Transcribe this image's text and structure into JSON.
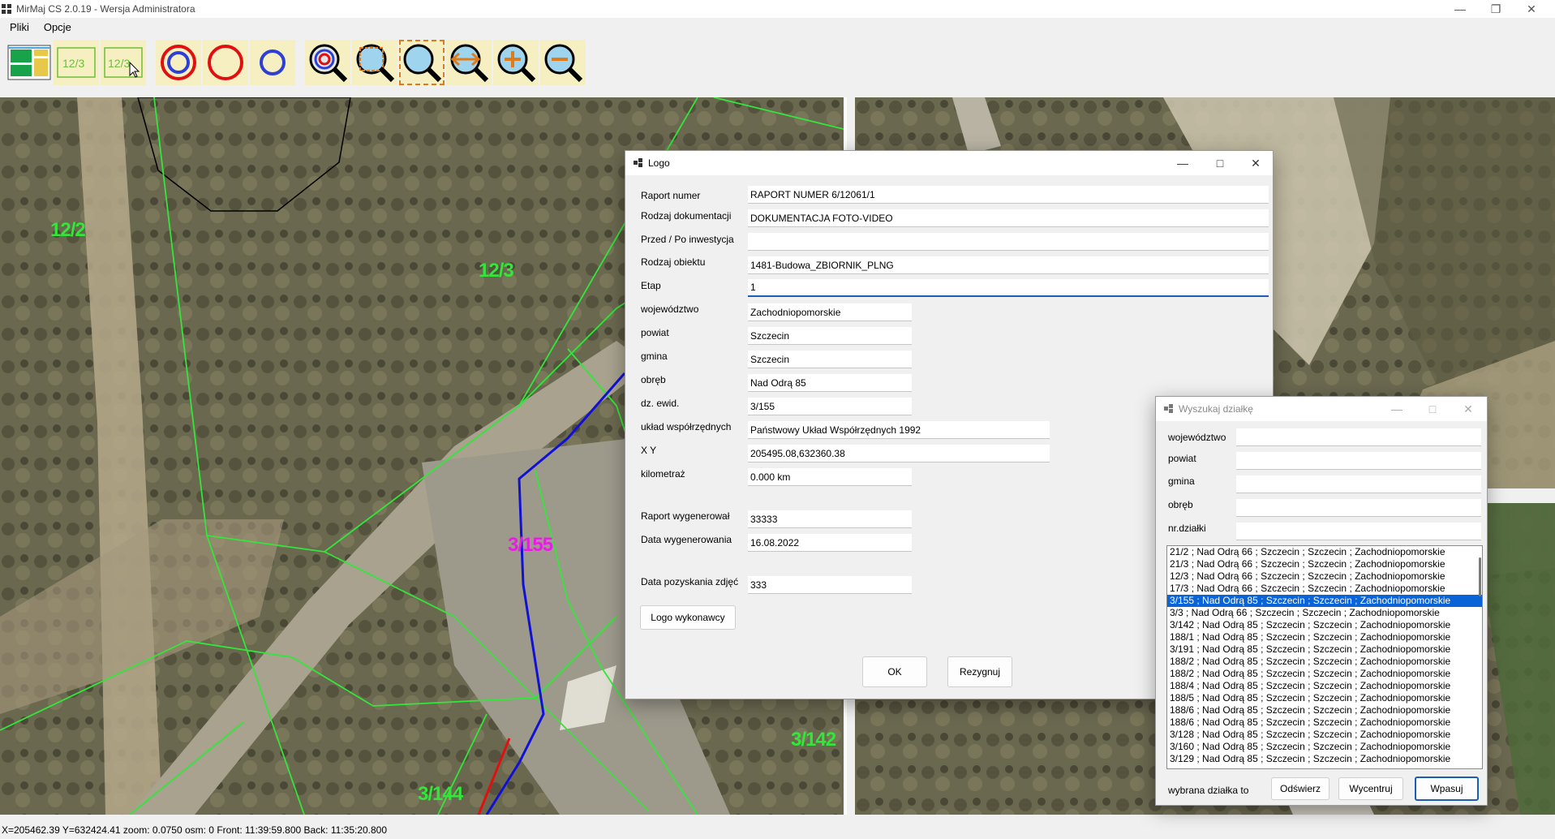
{
  "app": {
    "title": "MirMaj CS 2.0.19 - Wersja Administratora",
    "menu": [
      "Pliki",
      "Opcje"
    ],
    "toolbar": {
      "parcel_label_1": "12/3",
      "parcel_label_2": "12/3"
    }
  },
  "map": {
    "labels": {
      "p12_2": "12/2",
      "p12_3": "12/3",
      "p3_155": "3/155",
      "p3_142": "3/142",
      "p3_144": "3/144"
    },
    "colors": {
      "parcel_border": "#33e63a",
      "selected_label": "#e81ce6",
      "line_blue": "#1111d6",
      "line_red": "#e01010"
    }
  },
  "status": {
    "text": "X=205462.39 Y=632424.41   zoom: 0.0750  osm: 0   Front: 11:39:59.800  Back: 11:35:20.800"
  },
  "logo_dialog": {
    "title": "Logo",
    "fields": [
      {
        "label": "Raport numer",
        "value": "RAPORT NUMER 6/12061/1"
      },
      {
        "label": "Rodzaj dokumentacji",
        "value": "DOKUMENTACJA FOTO-VIDEO"
      },
      {
        "label": "Przed / Po inwestycja",
        "value": ""
      },
      {
        "label": "Rodzaj obiektu",
        "value": "1481-Budowa_ZBIORNIK_PLNG"
      },
      {
        "label": "Etap",
        "value": "1"
      },
      {
        "label": "województwo",
        "value": "Zachodniopomorskie"
      },
      {
        "label": "powiat",
        "value": "Szczecin"
      },
      {
        "label": "gmina",
        "value": "Szczecin"
      },
      {
        "label": "obręb",
        "value": "Nad Odrą 85"
      },
      {
        "label": "dz. ewid.",
        "value": "3/155"
      },
      {
        "label": "układ współrzędnych",
        "value": "Państwowy Układ Współrzędnych 1992"
      },
      {
        "label": "X Y",
        "value": "205495.08,632360.38"
      },
      {
        "label": "kilometraż",
        "value": "0.000 km"
      },
      {
        "label": "Raport wygenerował",
        "value": "33333"
      },
      {
        "label": "Data wygenerowania",
        "value": "16.08.2022"
      },
      {
        "label": "Data pozyskania zdjęć",
        "value": "333"
      }
    ],
    "logo_button": "Logo wykonawcy",
    "ok": "OK",
    "cancel": "Rezygnuj"
  },
  "search_dialog": {
    "title": "Wyszukaj działkę",
    "fields": [
      {
        "label": "województwo",
        "value": ""
      },
      {
        "label": "powiat",
        "value": ""
      },
      {
        "label": "gmina",
        "value": ""
      },
      {
        "label": "obręb",
        "value": ""
      },
      {
        "label": "nr.działki",
        "value": ""
      }
    ],
    "results": [
      "21/2 ; Nad Odrą 66 ; Szczecin ; Szczecin ; Zachodniopomorskie",
      "21/3 ; Nad Odrą 66 ; Szczecin ; Szczecin ; Zachodniopomorskie",
      "12/3 ; Nad Odrą 66 ; Szczecin ; Szczecin ; Zachodniopomorskie",
      "17/3 ; Nad Odrą 66 ; Szczecin ; Szczecin ; Zachodniopomorskie",
      "3/155 ; Nad Odrą 85 ; Szczecin ; Szczecin ; Zachodniopomorskie",
      "3/3 ; Nad Odrą 66 ; Szczecin ; Szczecin ; Zachodniopomorskie",
      "3/142 ; Nad Odrą 85 ; Szczecin ; Szczecin ; Zachodniopomorskie",
      "188/1 ; Nad Odrą 85 ; Szczecin ; Szczecin ; Zachodniopomorskie",
      "3/191 ; Nad Odrą 85 ; Szczecin ; Szczecin ; Zachodniopomorskie",
      "188/2 ; Nad Odrą 85 ; Szczecin ; Szczecin ; Zachodniopomorskie",
      "188/2 ; Nad Odrą 85 ; Szczecin ; Szczecin ; Zachodniopomorskie",
      "188/4 ; Nad Odrą 85 ; Szczecin ; Szczecin ; Zachodniopomorskie",
      "188/5 ; Nad Odrą 85 ; Szczecin ; Szczecin ; Zachodniopomorskie",
      "188/6 ; Nad Odrą 85 ; Szczecin ; Szczecin ; Zachodniopomorskie",
      "188/6 ; Nad Odrą 85 ; Szczecin ; Szczecin ; Zachodniopomorskie",
      "3/128 ; Nad Odrą 85 ; Szczecin ; Szczecin ; Zachodniopomorskie",
      "3/160 ; Nad Odrą 85 ; Szczecin ; Szczecin ; Zachodniopomorskie",
      "3/129 ; Nad Odrą 85 ; Szczecin ; Szczecin ; Zachodniopomorskie"
    ],
    "selected_index": 4,
    "selected_label": "wybrana działka to",
    "refresh": "Odświerz",
    "center": "Wycentruj",
    "fit": "Wpasuj"
  }
}
